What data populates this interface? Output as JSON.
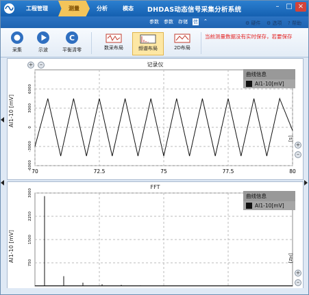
{
  "app": {
    "title": "DHDAS动态信号采集分析系统",
    "tabs": [
      {
        "label": "工程管理",
        "active": false
      },
      {
        "label": "测量",
        "active": true
      },
      {
        "label": "分析",
        "active": false
      },
      {
        "label": "模态",
        "active": false
      }
    ],
    "sub_links": [
      "参数",
      "参数",
      "存储",
      "信"
    ],
    "right_tools": {
      "hardware": "硬件",
      "options": "选项",
      "help": "帮助"
    }
  },
  "ribbon": {
    "buttons": [
      {
        "label": "采集",
        "icon": "record-icon"
      },
      {
        "label": "示波",
        "icon": "play-icon"
      },
      {
        "label": "平衡清零",
        "icon": "balance-icon"
      }
    ],
    "layouts": [
      {
        "label": "数采布局",
        "active": false
      },
      {
        "label": "频谱布局",
        "active": true
      },
      {
        "label": "2D布局",
        "active": false
      }
    ],
    "warning": "当前测量数据没有实时保存，若要保存"
  },
  "colors": {
    "titlebar": "#1a6ac0",
    "accent_tab": "#f3c45a",
    "warning": "#e32222",
    "legend_bg": "#a6a6a6"
  },
  "chart_data": [
    {
      "type": "line",
      "title": "记录仪",
      "ylabel": "AI1-10 [mV]",
      "xlabel": "[s]",
      "xlim": [
        70,
        80
      ],
      "ylim": [
        -6000,
        9000
      ],
      "x_ticks": [
        "70",
        "72.5",
        "75",
        "77.5",
        "80"
      ],
      "y_ticks": [
        "-6000",
        "-3000",
        "0",
        "3000",
        "6000"
      ],
      "grid": true,
      "legend": {
        "header": "曲线信息",
        "position": "top-right",
        "entries": [
          "AI1-10[mV]"
        ]
      },
      "series": [
        {
          "name": "AI1-10[mV]",
          "x": [
            70.0,
            70.5,
            71.0,
            71.5,
            72.0,
            72.5,
            73.0,
            73.5,
            74.0,
            74.5,
            75.0,
            75.5,
            76.0,
            76.5,
            77.0,
            77.5,
            78.0,
            78.5,
            79.0,
            79.5,
            80.0
          ],
          "y": [
            -3000,
            4500,
            -4500,
            4500,
            -4500,
            4500,
            -4500,
            4500,
            -4500,
            4500,
            -4500,
            4500,
            -4500,
            4500,
            -4500,
            4500,
            -4500,
            4500,
            -4500,
            4500,
            -500
          ]
        }
      ]
    },
    {
      "type": "line",
      "title": "FFT",
      "ylabel": "AI1-10 [mV]",
      "xlabel": "[Hz]",
      "ylim": [
        0,
        3000
      ],
      "y_ticks": [
        "750",
        "1500",
        "2250",
        "3000"
      ],
      "grid": true,
      "legend": {
        "header": "曲线信息",
        "position": "top-right",
        "entries": [
          "AI1-10[mV]"
        ]
      },
      "series": [
        {
          "name": "AI1-10[mV]",
          "peaks": [
            {
              "f": 1,
              "a": 2900
            },
            {
              "f": 3,
              "a": 320
            },
            {
              "f": 5,
              "a": 110
            },
            {
              "f": 7,
              "a": 60
            },
            {
              "f": 9,
              "a": 40
            },
            {
              "f": 11,
              "a": 25
            },
            {
              "f": 13,
              "a": 18
            }
          ]
        }
      ]
    }
  ]
}
